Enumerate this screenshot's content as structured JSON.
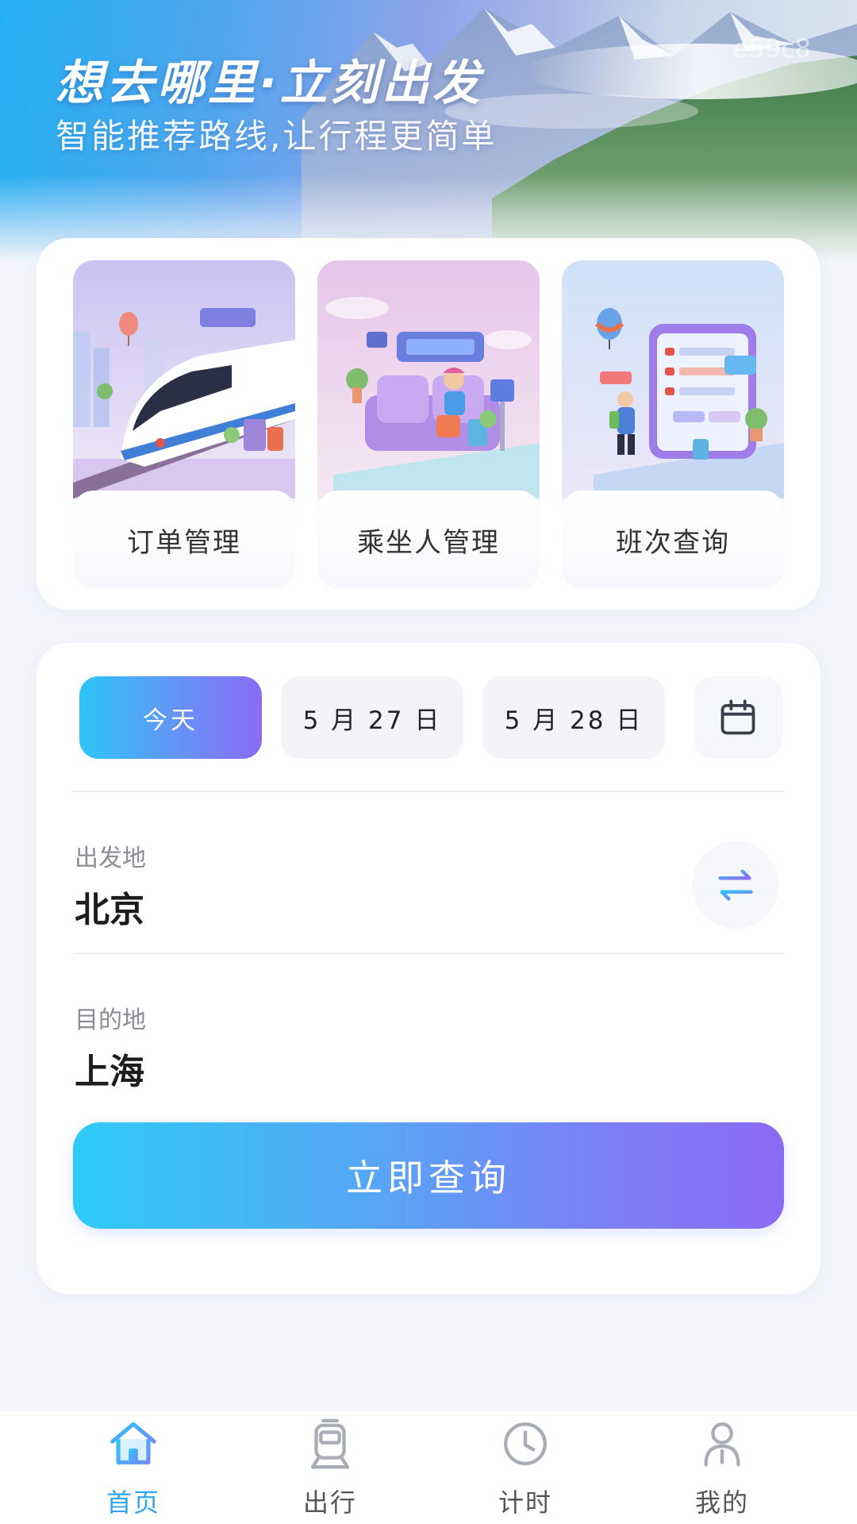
{
  "hero": {
    "title": "想去哪里·立刻出发",
    "subtitle": "智能推荐路线,让行程更简单",
    "code": "e59c8"
  },
  "features": [
    {
      "label": "订单管理",
      "icon": "train-illustration"
    },
    {
      "label": "乘坐人管理",
      "icon": "passenger-seat-illustration"
    },
    {
      "label": "班次查询",
      "icon": "schedule-board-illustration"
    }
  ],
  "search": {
    "dates": [
      "今天",
      "5 月 27 日",
      "5 月 28 日"
    ],
    "selected_date_index": 0,
    "calendar_icon": "calendar-icon",
    "origin_label": "出发地",
    "origin_value": "北京",
    "destination_label": "目的地",
    "destination_value": "上海",
    "swap_icon": "swap-arrows-icon",
    "query_button": "立即查询"
  },
  "nav": {
    "items": [
      {
        "label": "首页",
        "icon": "home-icon",
        "active": true
      },
      {
        "label": "出行",
        "icon": "train-icon",
        "active": false
      },
      {
        "label": "计时",
        "icon": "clock-icon",
        "active": false
      },
      {
        "label": "我的",
        "icon": "user-icon",
        "active": false
      }
    ]
  },
  "colors": {
    "accent_start": "#2ec5f7",
    "accent_end": "#8a6cf5",
    "active_nav": "#2ea7ee",
    "background": "#f4f6fb"
  }
}
